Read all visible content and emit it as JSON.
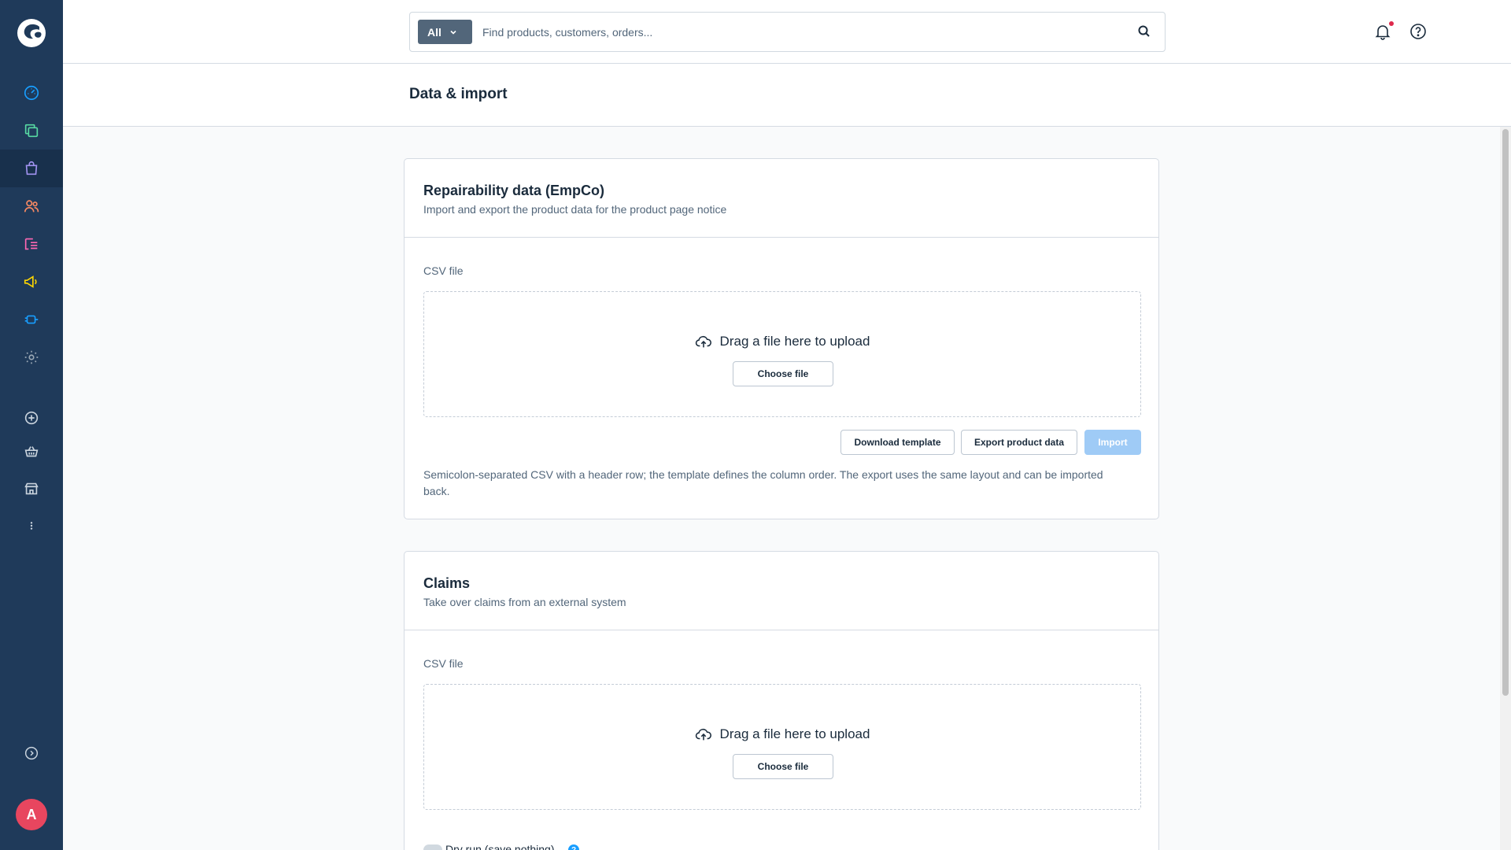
{
  "sidebar": {
    "logo": "shopware-logo-icon",
    "items": [
      {
        "name": "dashboard-icon",
        "color": "#189eff"
      },
      {
        "name": "catalogue-icon",
        "color": "#57d9a3"
      },
      {
        "name": "orders-icon",
        "color": "#a092f0"
      },
      {
        "name": "customers-icon",
        "color": "#f88962"
      },
      {
        "name": "content-icon",
        "color": "#ff68b4"
      },
      {
        "name": "marketing-icon",
        "color": "#ffd700"
      },
      {
        "name": "extensions-icon",
        "color": "#189eff"
      },
      {
        "name": "settings-icon",
        "color": "#9aa8b5"
      }
    ],
    "avatar_initial": "A"
  },
  "topbar": {
    "search_type": "All",
    "search_placeholder": "Find products, customers, orders..."
  },
  "page": {
    "title": "Data & import"
  },
  "cards": [
    {
      "title": "Repairability data (EmpCo)",
      "subtitle": "Import and export the product data for the product page notice",
      "field_label": "CSV file",
      "dropzone_text": "Drag a file here to upload",
      "choose_file": "Choose file",
      "download_template": "Download template",
      "export_data": "Export product data",
      "import": "Import",
      "help": "Semicolon-separated CSV with a header row; the template defines the column order. The export uses the same layout and can be imported back."
    },
    {
      "title": "Claims",
      "subtitle": "Take over claims from an external system",
      "field_label": "CSV file",
      "dropzone_text": "Drag a file here to upload",
      "choose_file": "Choose file",
      "dry_run_label": "Dry run (save nothing)",
      "help_badge": "?"
    }
  ],
  "colors": {
    "sidebar": "#1f3a5a",
    "accent": "#189eff",
    "notification_dot": "#de294c",
    "avatar": "#e8465f"
  }
}
